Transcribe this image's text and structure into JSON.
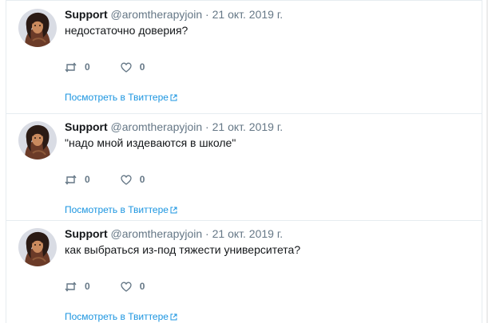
{
  "tweets": [
    {
      "author_name": "Support",
      "author_handle": "@aromtherapyjoin",
      "separator": "·",
      "date": "21 окт. 2019 г.",
      "text": "недостаточно доверия?",
      "retweet_count": "0",
      "like_count": "0",
      "view_link": "Посмотреть в Твиттере"
    },
    {
      "author_name": "Support",
      "author_handle": "@aromtherapyjoin",
      "separator": "·",
      "date": "21 окт. 2019 г.",
      "text": "\"надо мной издеваются в школе\"",
      "retweet_count": "0",
      "like_count": "0",
      "view_link": "Посмотреть в Твиттере"
    },
    {
      "author_name": "Support",
      "author_handle": "@aromtherapyjoin",
      "separator": "·",
      "date": "21 окт. 2019 г.",
      "text": "как выбраться из-под тяжести университета?",
      "retweet_count": "0",
      "like_count": "0",
      "view_link": "Посмотреть в Твиттере"
    }
  ],
  "colors": {
    "link": "#1b95e0",
    "muted": "#657786",
    "text": "#14171a",
    "border": "#e6ecf0"
  },
  "icons": {
    "retweet": "retweet-icon",
    "like": "heart-icon",
    "external": "external-link-icon"
  }
}
